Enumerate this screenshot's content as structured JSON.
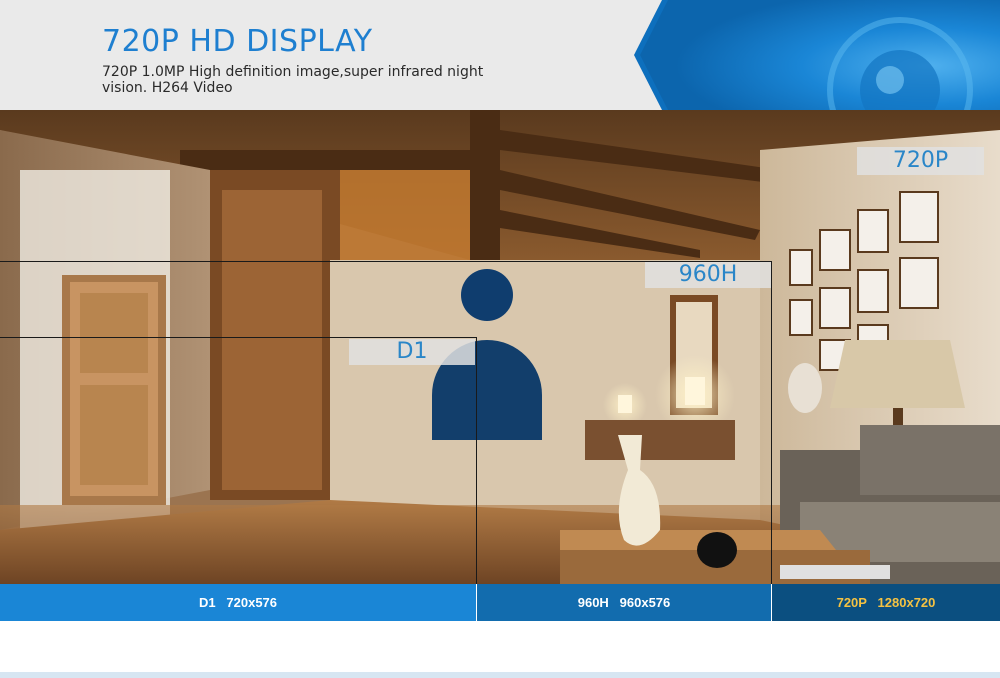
{
  "header": {
    "title": "720P HD DISPLAY",
    "subtitle": "720P 1.0MP High definition image,super infrared night vision. H264 Video"
  },
  "resolution_tags": {
    "p720": "720P",
    "h960": "960H",
    "d1": "D1"
  },
  "bottom_bar": {
    "d1": "D1   720x576",
    "h960": "960H   960x576",
    "p720": "720P   1280x720"
  },
  "colors": {
    "accent_blue": "#1e7fd0",
    "bar_d1": "#1a86d6",
    "bar_960h": "#126cae",
    "bar_720p": "#0b4f80",
    "bar_720p_text": "#f5c242"
  }
}
